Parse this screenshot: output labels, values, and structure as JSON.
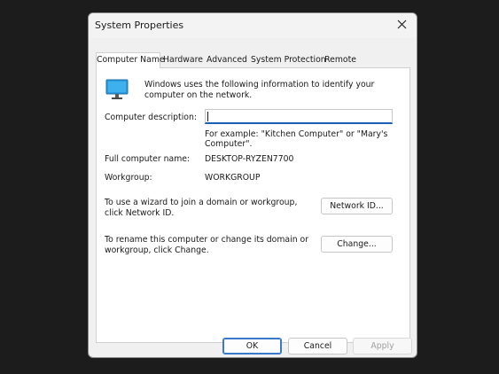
{
  "window": {
    "title": "System Properties"
  },
  "tabs": [
    {
      "label": "Computer Name",
      "active": true
    },
    {
      "label": "Hardware",
      "active": false
    },
    {
      "label": "Advanced",
      "active": false
    },
    {
      "label": "System Protection",
      "active": false
    },
    {
      "label": "Remote",
      "active": false
    }
  ],
  "panel": {
    "icon": "computer-monitor-icon",
    "intro": "Windows uses the following information to identify your computer on the network.",
    "description_label": "Computer description:",
    "description_value": "",
    "example": "For example: \"Kitchen Computer\" or \"Mary's Computer\".",
    "full_name_label": "Full computer name:",
    "full_name_value": "DESKTOP-RYZEN7700",
    "workgroup_label": "Workgroup:",
    "workgroup_value": "WORKGROUP",
    "network_text": "To use a wizard to join a domain or workgroup, click Network ID.",
    "network_button": "Network ID...",
    "change_text": "To rename this computer or change its domain or workgroup, click Change.",
    "change_button": "Change..."
  },
  "footer": {
    "ok": "OK",
    "cancel": "Cancel",
    "apply": "Apply"
  },
  "colors": {
    "accent": "#1a5fb4",
    "monitor": "#1e90d6"
  }
}
